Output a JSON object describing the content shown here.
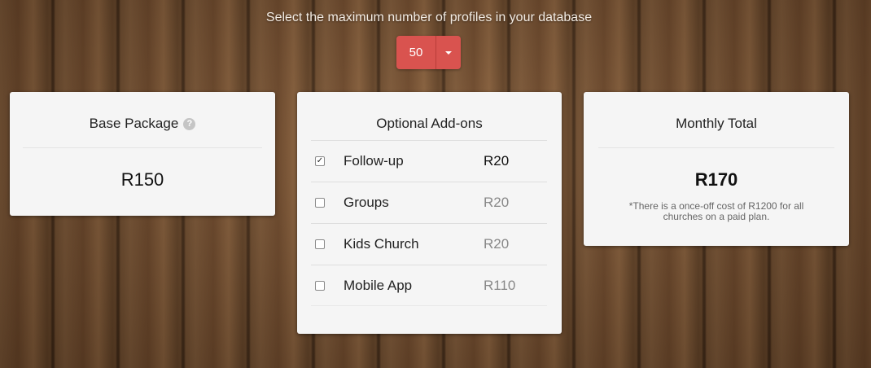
{
  "header": {
    "prompt": "Select the maximum number of profiles in your database"
  },
  "profile_select": {
    "value": "50",
    "color": "#d9534f"
  },
  "base_package": {
    "title": "Base Package",
    "help_icon": "?",
    "price": "R150"
  },
  "addons": {
    "title": "Optional Add-ons",
    "items": [
      {
        "name": "Follow-up",
        "price": "R20",
        "checked": true
      },
      {
        "name": "Groups",
        "price": "R20",
        "checked": false
      },
      {
        "name": "Kids Church",
        "price": "R20",
        "checked": false
      },
      {
        "name": "Mobile App",
        "price": "R110",
        "checked": false
      }
    ]
  },
  "monthly_total": {
    "title": "Monthly Total",
    "price": "R170",
    "note": "*There is a once-off cost of R1200 for all churches on a paid plan."
  }
}
